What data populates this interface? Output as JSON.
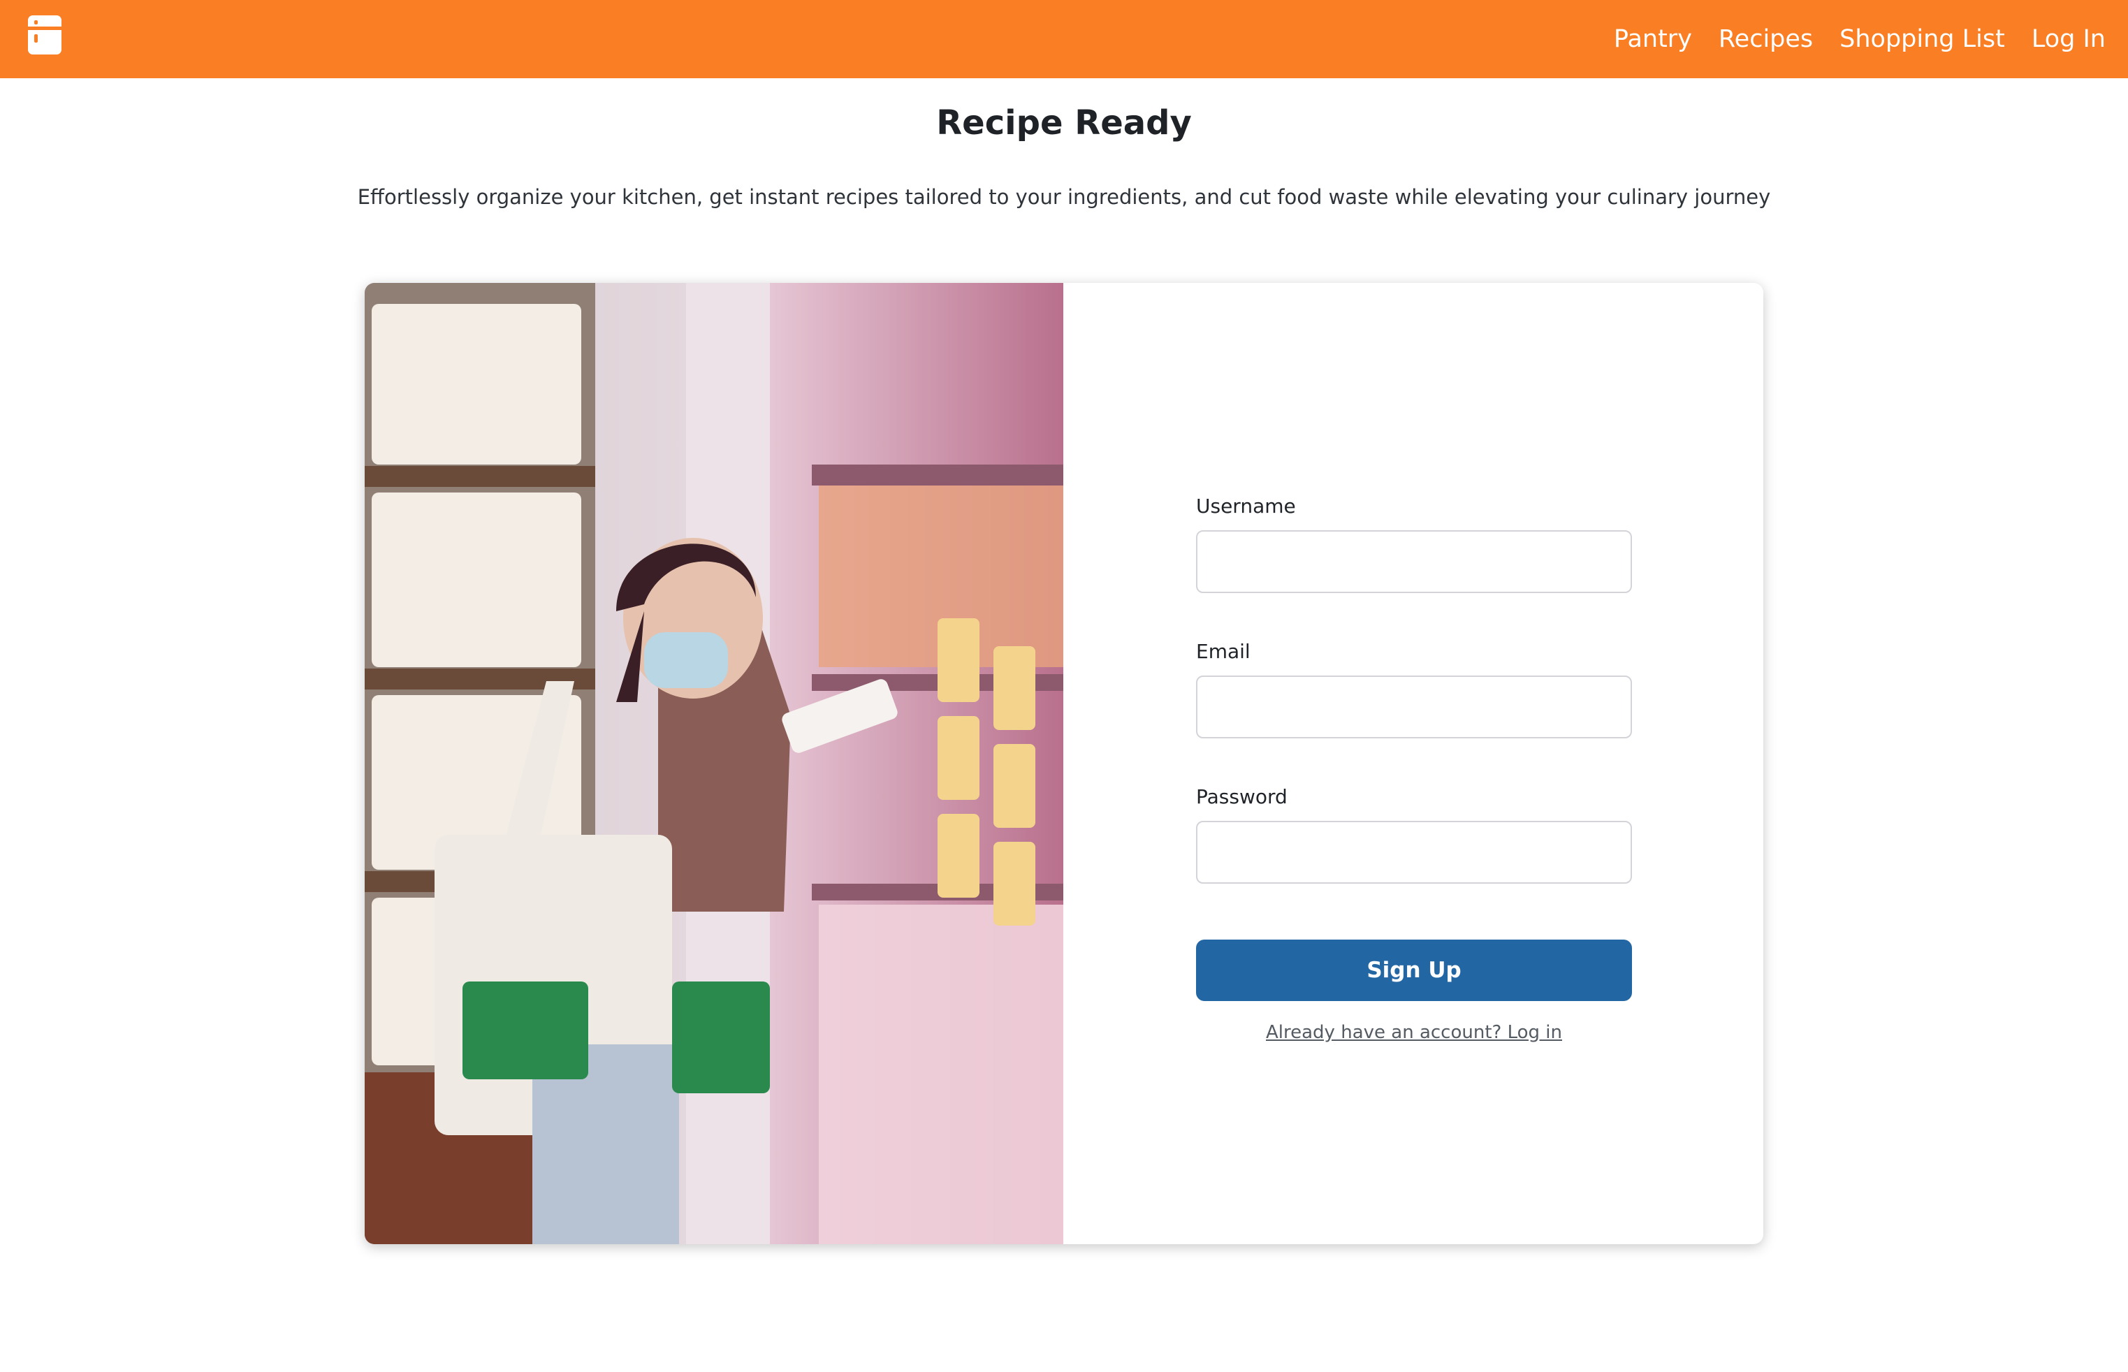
{
  "nav": {
    "logo_icon": "fridge-icon",
    "links": [
      "Pantry",
      "Recipes",
      "Shopping List",
      "Log In"
    ]
  },
  "hero": {
    "title": "Recipe Ready",
    "tagline": "Effortlessly organize your kitchen, get instant recipes tailored to your ingredients, and cut food waste while elevating your culinary journey"
  },
  "form": {
    "username_label": "Username",
    "username_value": "",
    "email_label": "Email",
    "email_value": "",
    "password_label": "Password",
    "password_value": "",
    "submit_label": "Sign Up",
    "login_link": "Already have an account? Log in"
  },
  "colors": {
    "nav_bg": "#fa7e23",
    "button_bg": "#2366a4"
  }
}
